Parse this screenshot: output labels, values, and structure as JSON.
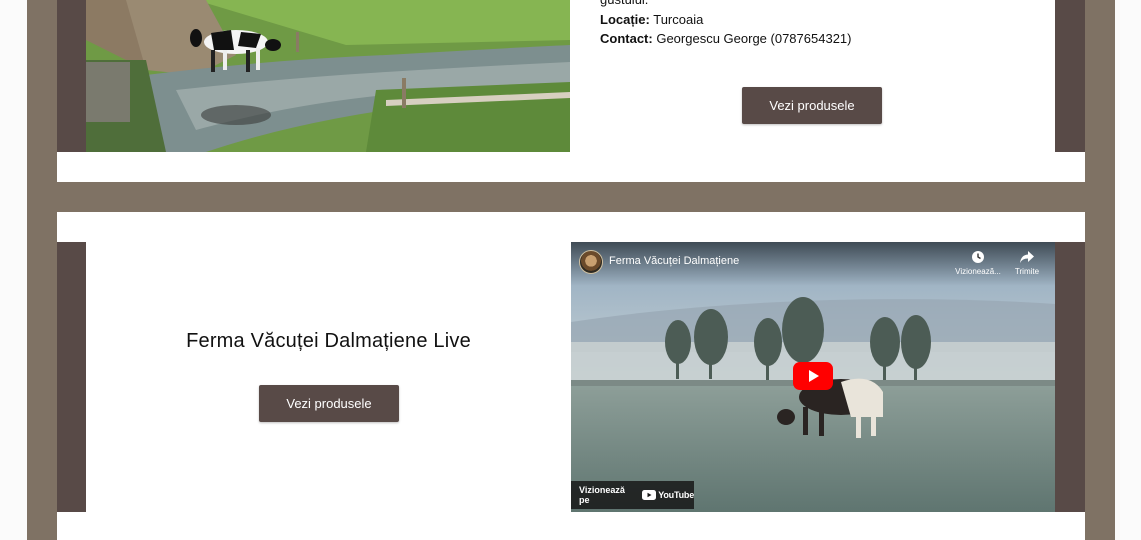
{
  "farm1": {
    "description_tail": "gustului.",
    "location_label": "Locație:",
    "location_value": "Turcoaia",
    "contact_label": "Contact:",
    "contact_value": "Georgescu George (0787654321)",
    "button_label": "Vezi produsele"
  },
  "farm2": {
    "title": "Ferma Văcuței Dalmațiene Live",
    "button_label": "Vezi produsele",
    "video": {
      "title": "Ferma Văcuței Dalmațiene",
      "watch_later_label": "Vizionează...",
      "share_label": "Trimite",
      "watch_on_label": "Vizionează pe",
      "youtube_label": "YouTube"
    }
  },
  "colors": {
    "frame": "#7f7264",
    "accent_dark": "#584a47",
    "card_bg": "#ffffff",
    "youtube_red": "#ff0000"
  }
}
